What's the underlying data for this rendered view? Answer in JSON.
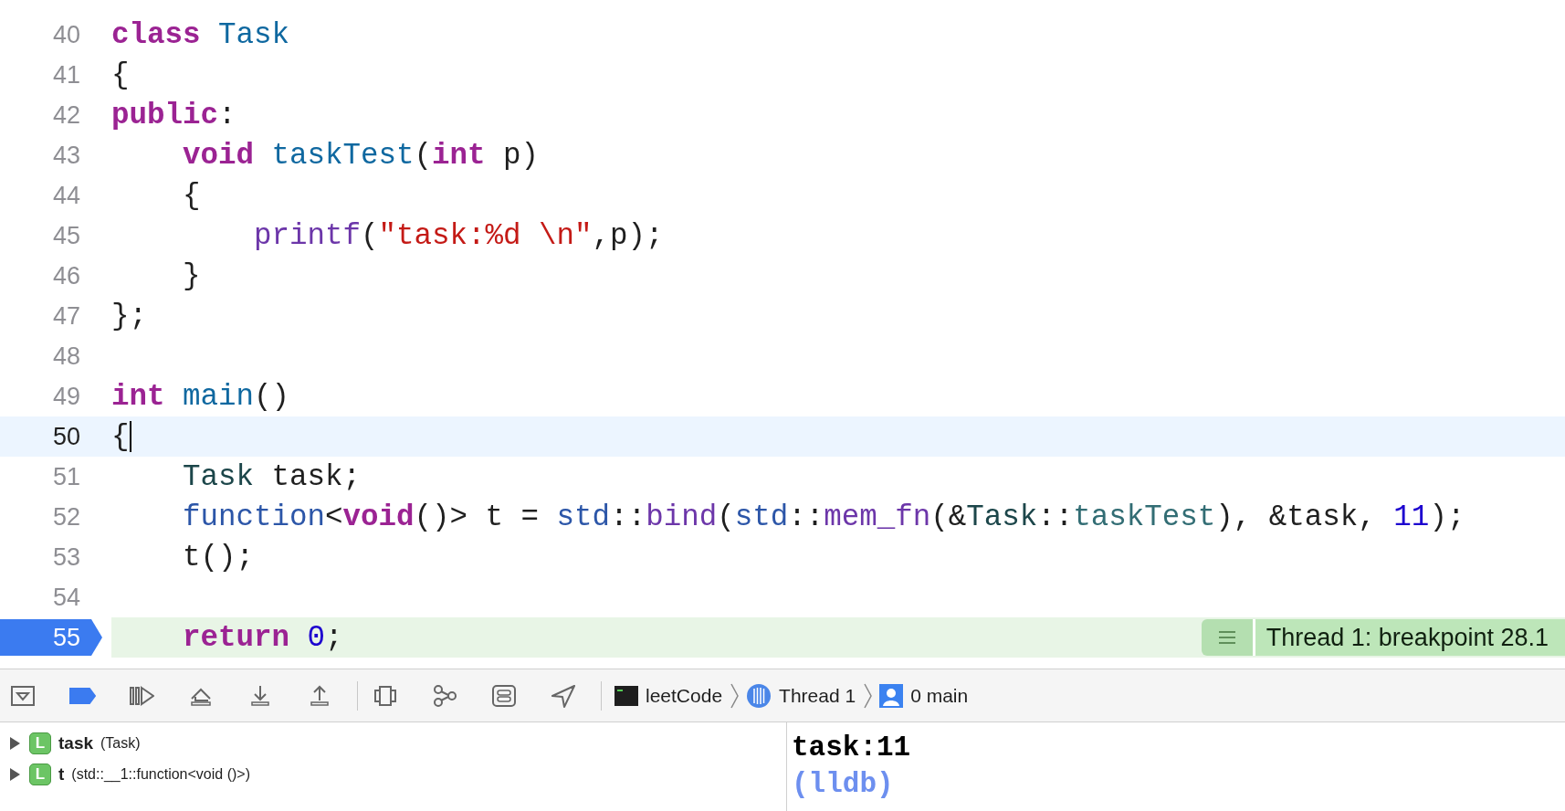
{
  "editor": {
    "lines": [
      {
        "number": "40",
        "tokens": [
          {
            "kind": "keyword",
            "text": "class"
          },
          {
            "kind": "decl",
            "text": " Task"
          }
        ]
      },
      {
        "number": "41",
        "tokens": [
          {
            "kind": "plain",
            "text": "{"
          }
        ]
      },
      {
        "number": "42",
        "tokens": [
          {
            "kind": "keyword",
            "text": "public"
          },
          {
            "kind": "plain",
            "text": ":"
          }
        ]
      },
      {
        "number": "43",
        "tokens": [
          {
            "kind": "keyword",
            "text": "    void"
          },
          {
            "kind": "decl",
            "text": " taskTest"
          },
          {
            "kind": "plain",
            "text": "("
          },
          {
            "kind": "keyword",
            "text": "int"
          },
          {
            "kind": "plain",
            "text": " p)"
          }
        ]
      },
      {
        "number": "44",
        "tokens": [
          {
            "kind": "plain",
            "text": "    {"
          }
        ]
      },
      {
        "number": "45",
        "tokens": [
          {
            "kind": "libfunc",
            "text": "        printf"
          },
          {
            "kind": "plain",
            "text": "("
          },
          {
            "kind": "string",
            "text": "\"task:%d \\n\""
          },
          {
            "kind": "plain",
            "text": ",p);"
          }
        ]
      },
      {
        "number": "46",
        "tokens": [
          {
            "kind": "plain",
            "text": "    }"
          }
        ]
      },
      {
        "number": "47",
        "tokens": [
          {
            "kind": "plain",
            "text": "};"
          }
        ]
      },
      {
        "number": "48"
      },
      {
        "number": "49",
        "tokens": [
          {
            "kind": "keyword",
            "text": "int"
          },
          {
            "kind": "decl",
            "text": " main"
          },
          {
            "kind": "plain",
            "text": "()"
          }
        ]
      },
      {
        "number": "50",
        "cursor": true,
        "tokens": [
          {
            "kind": "plain",
            "text": "{"
          }
        ]
      },
      {
        "number": "51",
        "tokens": [
          {
            "kind": "type",
            "text": "    Task"
          },
          {
            "kind": "plain",
            "text": " task;"
          }
        ]
      },
      {
        "number": "52",
        "tokens": [
          {
            "kind": "lib",
            "text": "    function"
          },
          {
            "kind": "plain",
            "text": "<"
          },
          {
            "kind": "keyword",
            "text": "void"
          },
          {
            "kind": "plain",
            "text": "()> t = "
          },
          {
            "kind": "lib",
            "text": "std"
          },
          {
            "kind": "plain",
            "text": "::"
          },
          {
            "kind": "libfunc",
            "text": "bind"
          },
          {
            "kind": "plain",
            "text": "("
          },
          {
            "kind": "lib",
            "text": "std"
          },
          {
            "kind": "plain",
            "text": "::"
          },
          {
            "kind": "libfunc",
            "text": "mem_fn"
          },
          {
            "kind": "plain",
            "text": "(&"
          },
          {
            "kind": "type",
            "text": "Task"
          },
          {
            "kind": "plain",
            "text": "::"
          },
          {
            "kind": "member",
            "text": "taskTest"
          },
          {
            "kind": "plain",
            "text": "), &task, "
          },
          {
            "kind": "number",
            "text": "11"
          },
          {
            "kind": "plain",
            "text": ");"
          }
        ]
      },
      {
        "number": "53",
        "tokens": [
          {
            "kind": "plain",
            "text": "    t();"
          }
        ]
      },
      {
        "number": "54"
      },
      {
        "number": "55",
        "breakpoint": true,
        "tokens": [
          {
            "kind": "keyword",
            "text": "    return"
          },
          {
            "kind": "number",
            "text": " 0"
          },
          {
            "kind": "plain",
            "text": ";"
          }
        ],
        "annotation": "Thread 1: breakpoint 28.1"
      }
    ]
  },
  "debug_bar": {
    "breakpoints_active": true,
    "path": [
      {
        "kind": "process",
        "label": "leetCode"
      },
      {
        "kind": "thread",
        "label": "Thread 1"
      },
      {
        "kind": "frame",
        "label": "0 main"
      }
    ]
  },
  "variables": [
    {
      "badge": "L",
      "name": "task",
      "type": "(Task)",
      "expanded": false
    },
    {
      "badge": "L",
      "name": "t",
      "type": "(std::__1::function<void ()>)",
      "expanded": false
    }
  ],
  "console": [
    {
      "kind": "output",
      "text": "task:11"
    },
    {
      "kind": "prompt",
      "text": "(lldb)"
    }
  ]
}
